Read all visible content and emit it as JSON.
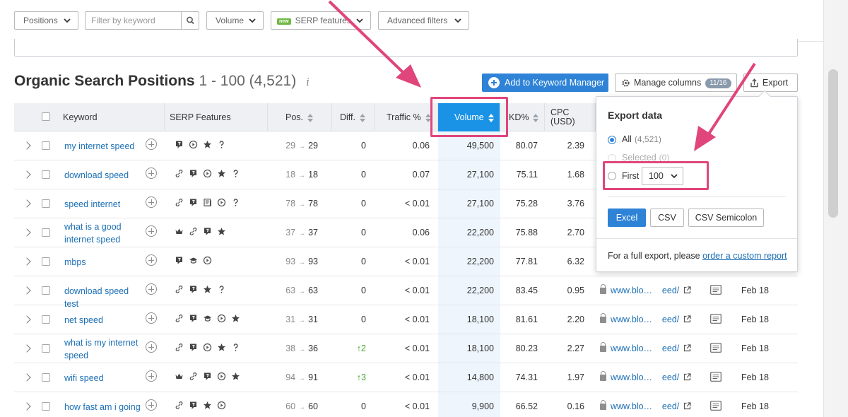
{
  "filters": {
    "positions": "Positions",
    "keyword_placeholder": "Filter by keyword",
    "volume": "Volume",
    "serp_badge": "new",
    "serp": "SERP features",
    "advanced": "Advanced filters"
  },
  "header": {
    "title": "Organic Search Positions",
    "range": "1 - 100",
    "total": "(4,521)",
    "info": "i"
  },
  "toolbar": {
    "add_keyword_manager": "Add to Keyword Manager",
    "manage_columns": "Manage columns",
    "columns_count": "11/16",
    "export": "Export"
  },
  "table": {
    "headers": {
      "keyword": "Keyword",
      "serp_features": "SERP Features",
      "pos": "Pos.",
      "diff": "Diff.",
      "traffic": "Traffic %",
      "volume": "Volume",
      "kd": "KD%",
      "cpc": "CPC\n(USD)"
    },
    "rows": [
      {
        "keyword": "my internet speed",
        "features": [
          "featured-snippet-icon",
          "play-icon",
          "star-icon",
          "question-icon"
        ],
        "pos_from": "29",
        "pos_to": "29",
        "diff": "0",
        "traffic": "0.06",
        "volume": "49,500",
        "kd": "80.07",
        "cpc": "2.39",
        "url": "",
        "date": ""
      },
      {
        "keyword": "download speed",
        "features": [
          "link-icon",
          "featured-snippet-icon",
          "play-icon",
          "star-icon",
          "question-icon"
        ],
        "pos_from": "18",
        "pos_to": "18",
        "diff": "0",
        "traffic": "0.07",
        "volume": "27,100",
        "kd": "75.11",
        "cpc": "1.68",
        "url": "",
        "date": ""
      },
      {
        "keyword": "speed internet",
        "features": [
          "link-icon",
          "featured-snippet-icon",
          "news-icon",
          "play-icon",
          "question-icon"
        ],
        "pos_from": "78",
        "pos_to": "78",
        "diff": "0",
        "traffic": "< 0.01",
        "volume": "27,100",
        "kd": "75.28",
        "cpc": "3.76",
        "url": "",
        "date": ""
      },
      {
        "keyword": "what is a good internet speed",
        "features": [
          "crown-icon",
          "link-icon",
          "featured-snippet-icon",
          "star-icon"
        ],
        "pos_from": "37",
        "pos_to": "37",
        "diff": "0",
        "traffic": "0.06",
        "volume": "22,200",
        "kd": "75.88",
        "cpc": "2.70",
        "url": "",
        "date": ""
      },
      {
        "keyword": "mbps",
        "features": [
          "featured-snippet-icon",
          "graduation-icon",
          "play-icon"
        ],
        "pos_from": "93",
        "pos_to": "93",
        "diff": "0",
        "traffic": "< 0.01",
        "volume": "22,200",
        "kd": "77.81",
        "cpc": "6.32",
        "url": "",
        "date": ""
      },
      {
        "keyword": "download speed test",
        "features": [
          "link-icon",
          "featured-snippet-icon",
          "star-icon",
          "question-icon"
        ],
        "pos_from": "63",
        "pos_to": "63",
        "diff": "0",
        "traffic": "< 0.01",
        "volume": "22,200",
        "kd": "83.45",
        "cpc": "0.95",
        "url": "www.blo…    eed/",
        "date": "Feb 18"
      },
      {
        "keyword": "net speed",
        "features": [
          "link-icon",
          "featured-snippet-icon",
          "graduation-icon",
          "play-icon",
          "star-icon"
        ],
        "pos_from": "31",
        "pos_to": "31",
        "diff": "0",
        "traffic": "< 0.01",
        "volume": "18,100",
        "kd": "81.61",
        "cpc": "2.20",
        "url": "www.blo…    eed/",
        "date": "Feb 18"
      },
      {
        "keyword": "what is my internet speed",
        "features": [
          "link-icon",
          "featured-snippet-icon",
          "play-icon",
          "star-icon",
          "question-icon"
        ],
        "pos_from": "38",
        "pos_to": "36",
        "diff": "↑2",
        "traffic": "< 0.01",
        "volume": "18,100",
        "kd": "80.23",
        "cpc": "2.27",
        "url": "www.blo…    eed/",
        "date": "Feb 18"
      },
      {
        "keyword": "wifi speed",
        "features": [
          "crown-icon",
          "link-icon",
          "featured-snippet-icon",
          "play-icon",
          "star-icon"
        ],
        "pos_from": "94",
        "pos_to": "91",
        "diff": "↑3",
        "traffic": "< 0.01",
        "volume": "14,800",
        "kd": "74.31",
        "cpc": "1.97",
        "url": "www.blo…    eed/",
        "date": "Feb 18"
      },
      {
        "keyword": "how fast am i going",
        "features": [
          "link-icon",
          "featured-snippet-icon",
          "star-icon",
          "play-icon"
        ],
        "pos_from": "60",
        "pos_to": "60",
        "diff": "0",
        "traffic": "< 0.01",
        "volume": "9,900",
        "kd": "66.52",
        "cpc": "0.16",
        "url": "www.blo…    eed/",
        "date": "Feb 18"
      }
    ]
  },
  "export_panel": {
    "title": "Export data",
    "all_label": "All",
    "all_count": "(4,521)",
    "selected_label": "Selected",
    "selected_count": "(0)",
    "first_label": "First",
    "first_value": "100",
    "formats": [
      "Excel",
      "CSV",
      "CSV Semicolon"
    ],
    "footer_text": "For a full export, please ",
    "footer_link": "order a custom report"
  },
  "colors": {
    "accent": "#2e83d7",
    "active_header": "#1a93e6",
    "annotation": "#e0457b",
    "positive": "#46a52d"
  }
}
